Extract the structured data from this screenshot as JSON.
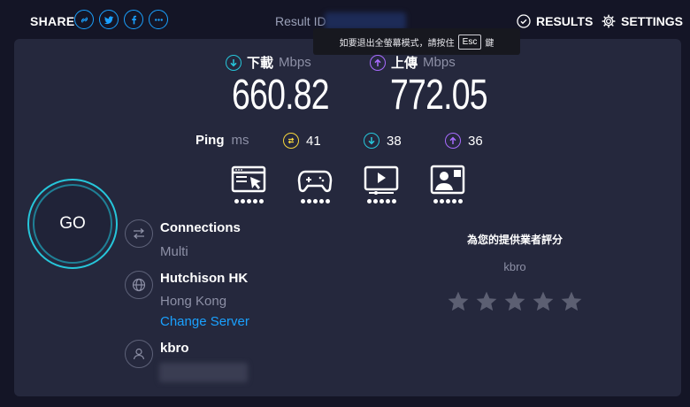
{
  "header": {
    "share_label": "SHARE",
    "share_buttons": [
      "link-icon",
      "twitter-icon",
      "facebook-icon",
      "more-icon"
    ],
    "result_id_label": "Result ID",
    "results_label": "RESULTS",
    "settings_label": "SETTINGS"
  },
  "tooltip": {
    "text_before": "如要退出全螢幕模式，請按住",
    "key": "Esc",
    "text_after": "鍵"
  },
  "download": {
    "label": "下載",
    "unit": "Mbps",
    "value": "660.82"
  },
  "upload": {
    "label": "上傳",
    "unit": "Mbps",
    "value": "772.05"
  },
  "ping": {
    "label": "Ping",
    "unit": "ms",
    "idle": "41",
    "download": "38",
    "upload": "36"
  },
  "apps": [
    {
      "icon": "web-browsing-icon",
      "rating": 5
    },
    {
      "icon": "gaming-icon",
      "rating": 5
    },
    {
      "icon": "video-streaming-icon",
      "rating": 5
    },
    {
      "icon": "video-chat-icon",
      "rating": 5
    }
  ],
  "go_label": "GO",
  "connections": {
    "title": "Connections",
    "value": "Multi"
  },
  "server": {
    "isp": "Hutchison HK",
    "location": "Hong Kong",
    "change_label": "Change Server"
  },
  "user": {
    "name": "kbro"
  },
  "rating": {
    "title": "為您的提供業者評分",
    "isp": "kbro",
    "stars": 5
  },
  "colors": {
    "accent": "#1aa1ff",
    "download": "#26c6da",
    "upload": "#a86bff",
    "ping_idle": "#f5d53c",
    "panel": "#25283d",
    "background": "#141526"
  }
}
